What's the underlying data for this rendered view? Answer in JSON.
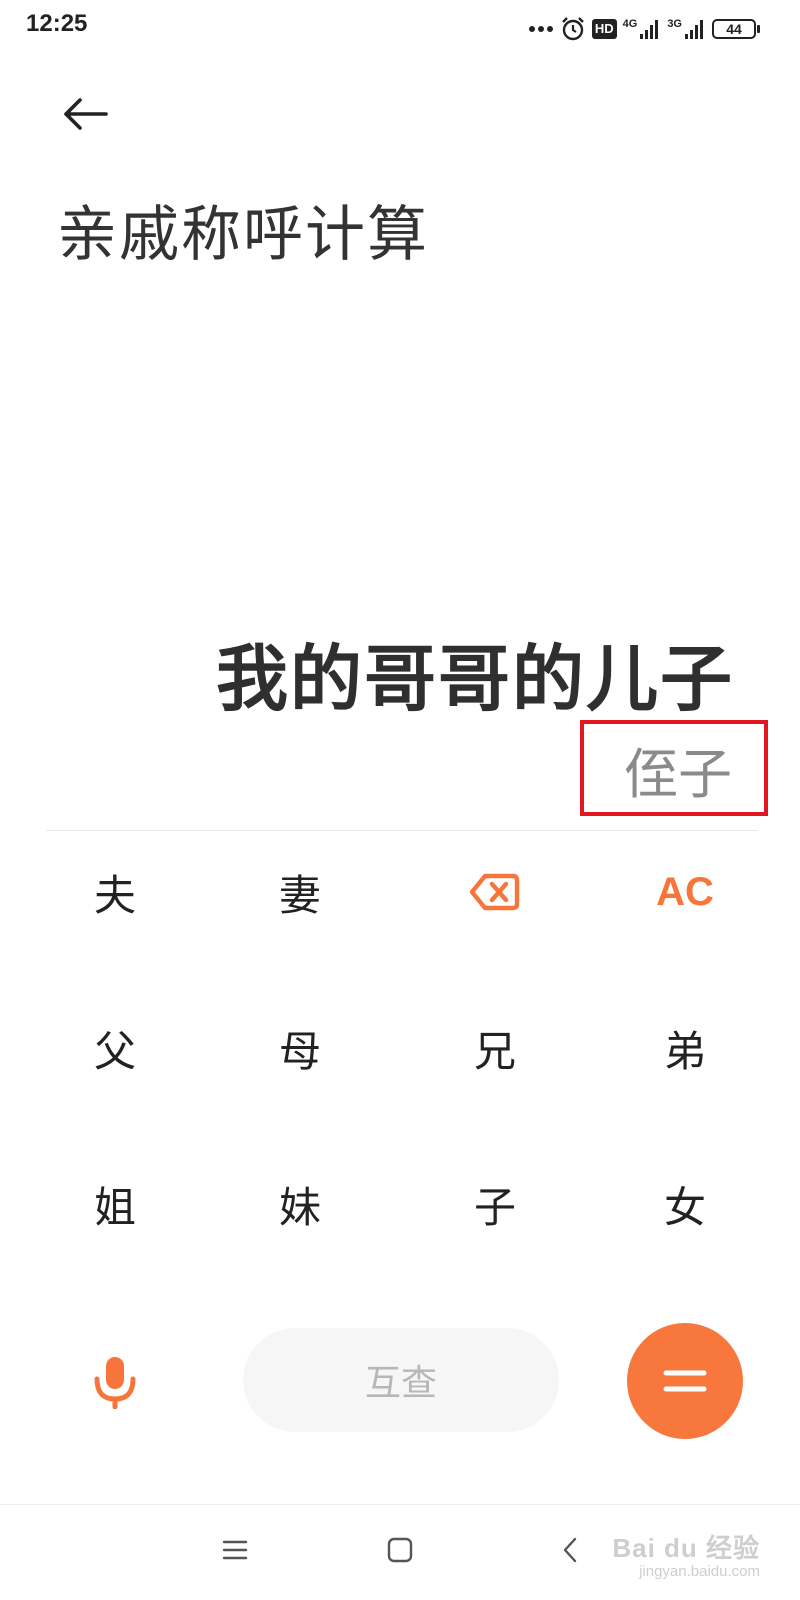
{
  "status_bar": {
    "time": "12:25",
    "battery": "44",
    "network_1": "4G",
    "network_2": "3G",
    "hd_label": "HD"
  },
  "header": {
    "title": "亲戚称呼计算"
  },
  "display": {
    "expression": "我的哥哥的儿子",
    "result": "侄子"
  },
  "keypad": {
    "rows": [
      [
        "夫",
        "妻",
        "delete",
        "AC"
      ],
      [
        "父",
        "母",
        "兄",
        "弟"
      ],
      [
        "姐",
        "妹",
        "子",
        "女"
      ]
    ],
    "husband": "夫",
    "wife": "妻",
    "clear": "AC",
    "father": "父",
    "mother": "母",
    "older_brother": "兄",
    "younger_brother": "弟",
    "older_sister": "姐",
    "younger_sister": "妹",
    "son": "子",
    "daughter": "女",
    "mutual": "互查"
  },
  "watermark": {
    "top": "Bai du 经验",
    "bottom": "jingyan.baidu.com"
  },
  "colors": {
    "accent": "#f7743b",
    "highlight_box": "#e3161f",
    "result_text": "#8a8a8a"
  }
}
